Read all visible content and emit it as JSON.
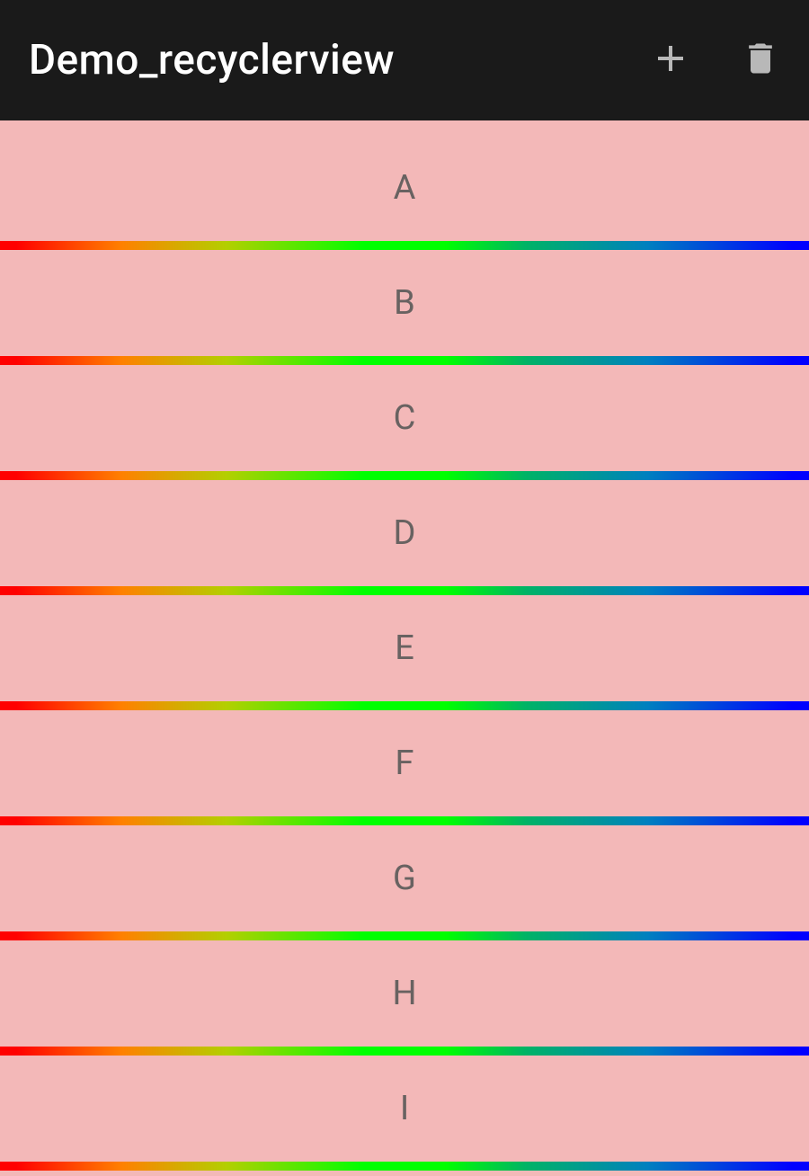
{
  "toolbar": {
    "title": "Demo_recyclerview"
  },
  "icons": {
    "add": "add-icon",
    "delete": "delete-icon"
  },
  "list": {
    "items": [
      {
        "label": "A"
      },
      {
        "label": "B"
      },
      {
        "label": "C"
      },
      {
        "label": "D"
      },
      {
        "label": "E"
      },
      {
        "label": "F"
      },
      {
        "label": "G"
      },
      {
        "label": "H"
      },
      {
        "label": "I"
      }
    ]
  },
  "colors": {
    "item_background": "#f3b8b8",
    "toolbar_background": "#1a1a1a",
    "text_label": "#686261"
  }
}
